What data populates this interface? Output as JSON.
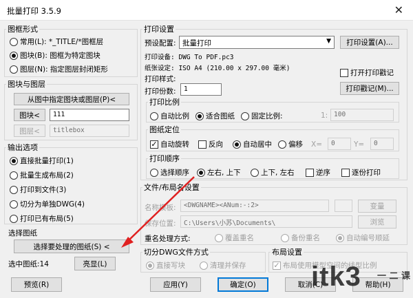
{
  "window": {
    "title": "批量打印 3.5.9",
    "close": "✕"
  },
  "frame_style": {
    "legend": "图框形式",
    "opt1": "常用(L): *_TITLE/*图框层",
    "opt2": "图块(B): 图框为特定图块",
    "opt3": "图层(N): 指定图层封闭矩形"
  },
  "block_layer": {
    "legend": "图块与图层",
    "pick_button": "从图中指定图块或图层(P)<",
    "block_button": "图块<",
    "block_value": "111",
    "layer_button": "图层<",
    "layer_value": "titlebox"
  },
  "output": {
    "legend": "输出选项",
    "opt1": "直接批量打印(1)",
    "opt2": "批量生成布局(2)",
    "opt3": "打印到文件(3)",
    "opt4": "切分为单独DWG(4)",
    "opt5": "打印已有布局(5)"
  },
  "select": {
    "legend": "选择图纸",
    "button": "选择要处理的图纸(S) <",
    "count_label": "选中图纸:14",
    "highlight_button": "亮显(L)"
  },
  "print_settings": {
    "legend": "打印设置",
    "preset_label": "预设配置:",
    "preset_value": "批量打印",
    "setup_button": "打印设置(A)...",
    "device": "打印设备: DWG To PDF.pc3",
    "paper": "纸张设定: ISO A4 (210.00 x 297.00 毫米)",
    "style": "打印样式:",
    "stamp_check": "打开打印戳记",
    "stamp_button": "打印戳记(M)...",
    "copies_label": "打印份数:",
    "copies_value": "1"
  },
  "scale": {
    "legend": "打印比例",
    "opt1": "自动比例",
    "opt2": "适合图纸",
    "opt3": "固定比例:",
    "ratio_prefix": "1:",
    "ratio_value": "100"
  },
  "position": {
    "legend": "图纸定位",
    "rotate": "自动旋转",
    "reverse": "反向",
    "center": "自动居中",
    "offset": "偏移",
    "x_label": "X=",
    "x_value": "0",
    "y_label": "Y=",
    "y_value": "0"
  },
  "order": {
    "legend": "打印顺序",
    "opt1": "选择顺序",
    "opt2": "左右, 上下",
    "opt3": "上下, 左右",
    "reverse": "逆序",
    "reverse_print": "逐份打印"
  },
  "file_layout": {
    "legend": "文件/布局名设置",
    "name_label": "名称模板:",
    "name_value": "<DWGNAME><ANum:-:2>",
    "change_button": "变量",
    "path_label": "保存位置:",
    "path_value": "C:\\Users\\小苏\\Documents\\",
    "browse_button": "浏览",
    "dup_label": "重名处理方式:",
    "dup1": "覆盖重名",
    "dup2": "备份重名",
    "dup3": "自动编号顺延"
  },
  "split": {
    "legend": "切分DWG文件方式",
    "opt1": "直接写块",
    "opt2": "清理并保存"
  },
  "layout_settings": {
    "legend": "布局设置",
    "check": "布局使用模型空间的线型比例"
  },
  "footer": {
    "preview": "预览(R)",
    "apply": "应用(Y)",
    "ok": "确定(O)",
    "cancel": "取消(C)",
    "help": "帮助(H)"
  },
  "watermark": {
    "text": "itk3",
    "sub": "一 二 课"
  }
}
